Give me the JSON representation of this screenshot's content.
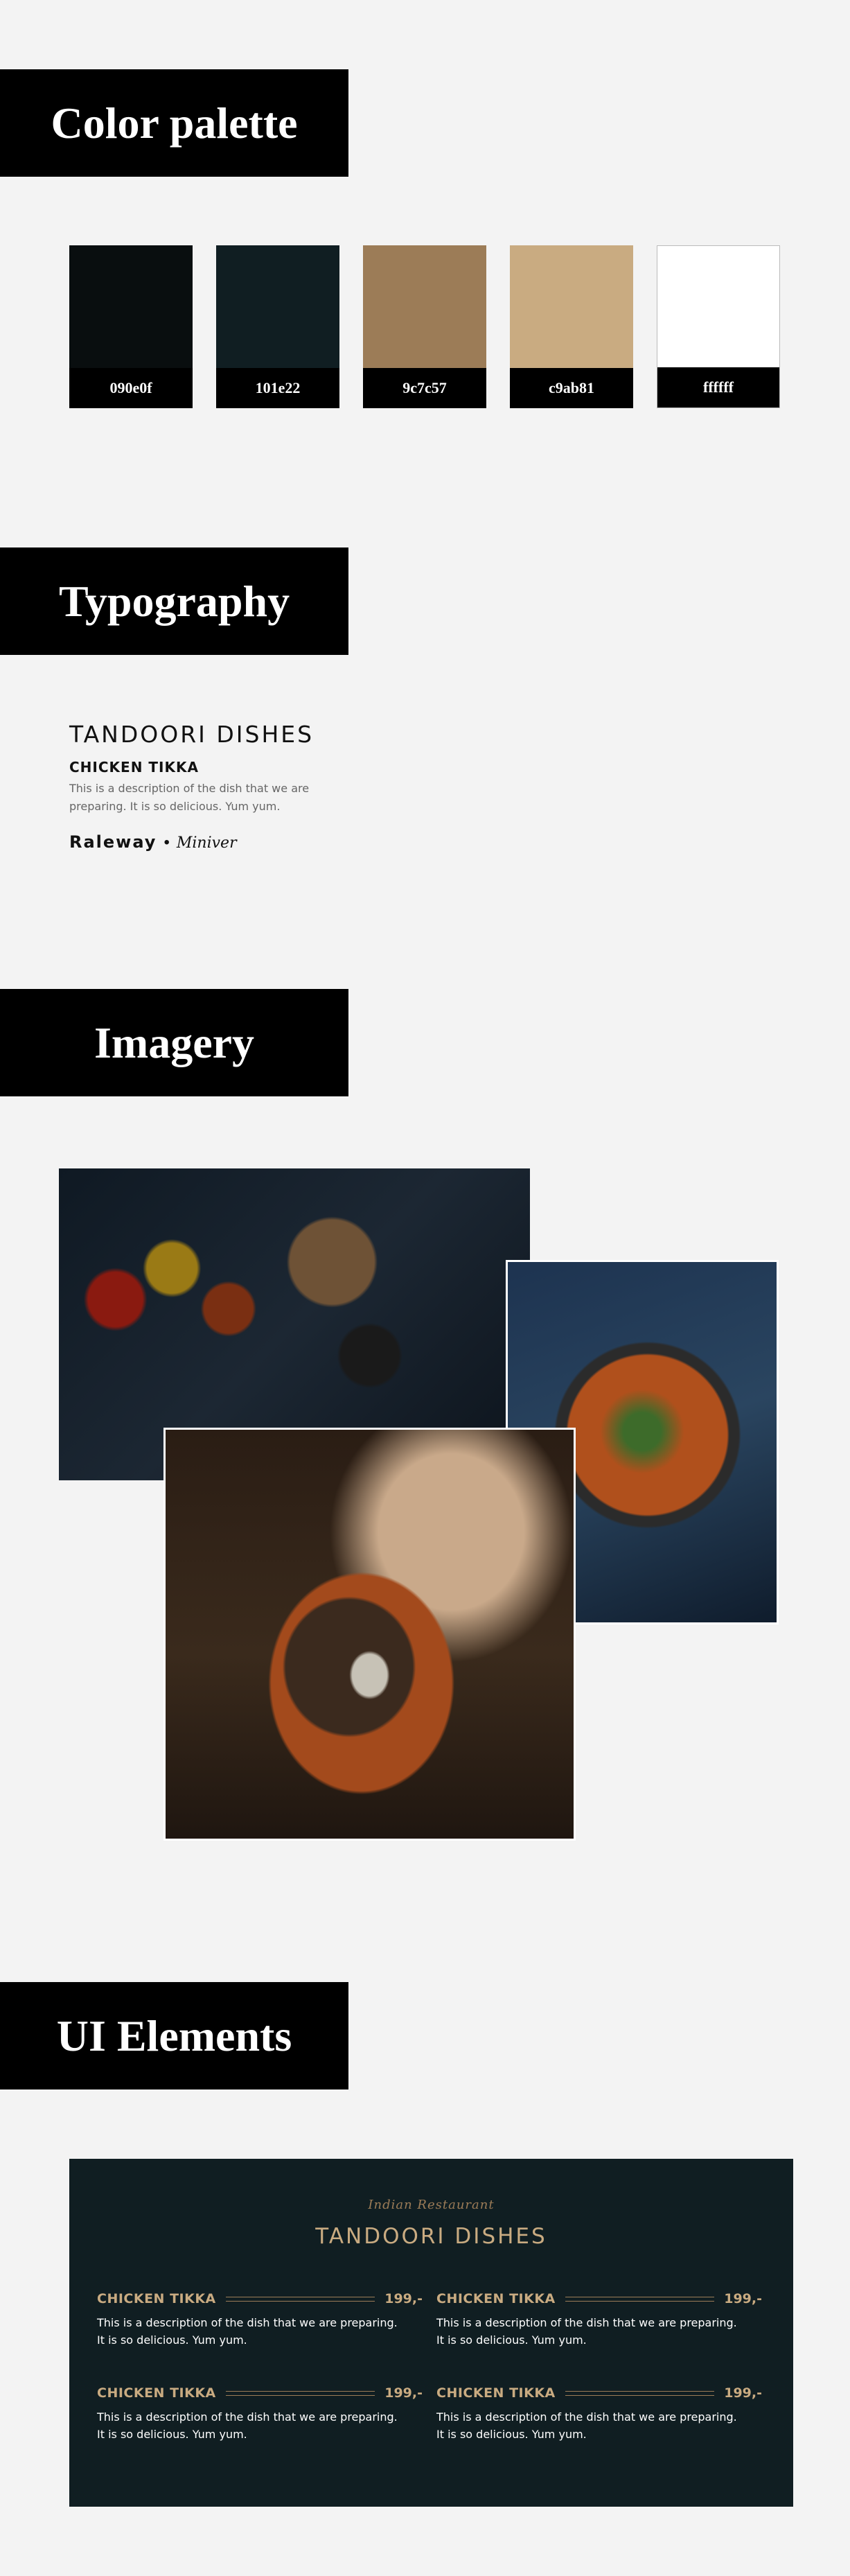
{
  "sections": {
    "color_palette": "Color palette",
    "typography": "Typography",
    "imagery": "Imagery",
    "ui_elements": "UI Elements"
  },
  "palette": [
    {
      "code": "090e0f",
      "color": "#090e0f"
    },
    {
      "code": "101e22",
      "color": "#101e22"
    },
    {
      "code": "9c7c57",
      "color": "#9c7c57"
    },
    {
      "code": "c9ab81",
      "color": "#c9ab81"
    },
    {
      "code": "ffffff",
      "color": "#ffffff"
    }
  ],
  "typography": {
    "heading": "TANDOORI DISHES",
    "subheading": "CHICKEN TIKKA",
    "description_line1": "This is a description of the dish that we are",
    "description_line2": "preparing. It is so delicious. Yum yum.",
    "font_primary": "Raleway",
    "separator": "•",
    "font_script": "Miniver"
  },
  "menu": {
    "script_label": "Indian Restaurant",
    "title": "TANDOORI DISHES",
    "items": [
      {
        "name": "CHICKEN TIKKA",
        "price": "199,-",
        "desc1": "This is a description of the dish that we are preparing.",
        "desc2": "It is so delicious. Yum yum."
      },
      {
        "name": "CHICKEN TIKKA",
        "price": "199,-",
        "desc1": "This is a description of the dish that we are preparing.",
        "desc2": "It is so delicious. Yum yum."
      },
      {
        "name": "CHICKEN TIKKA",
        "price": "199,-",
        "desc1": "This is a description of the dish that we are preparing.",
        "desc2": "It is so delicious. Yum yum."
      },
      {
        "name": "CHICKEN TIKKA",
        "price": "199,-",
        "desc1": "This is a description of the dish that we are preparing.",
        "desc2": "It is so delicious. Yum yum."
      }
    ]
  },
  "colors": {
    "page_background": "#f3f3f3",
    "header_background": "#000000",
    "card_background": "#101e22",
    "accent_dark": "#9c7c57",
    "accent_light": "#c9ab81"
  }
}
